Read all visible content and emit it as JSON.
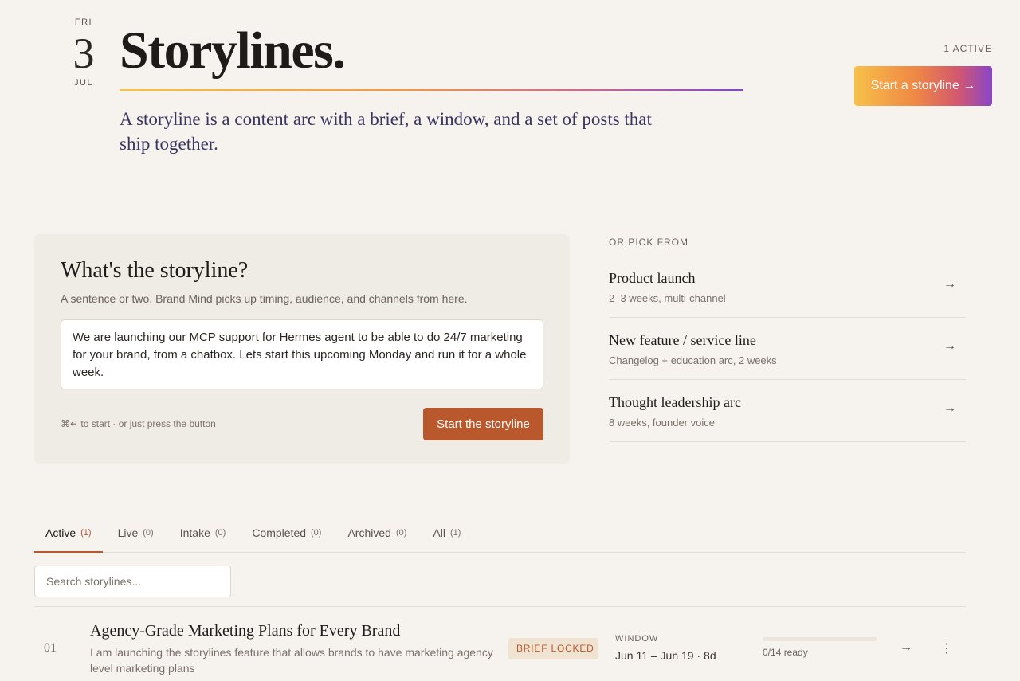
{
  "date": {
    "dow": "FRI",
    "day": "3",
    "month": "JUL"
  },
  "header": {
    "title": "Storylines.",
    "subtitle": "A storyline is a content arc with a brief, a window, and a set of posts that ship together.",
    "active_count": "1 ACTIVE",
    "start_button": "Start a storyline →"
  },
  "composer": {
    "heading": "What's the storyline?",
    "hint": "A sentence or two. Brand Mind picks up timing, audience, and channels from here.",
    "input_value": "We are launching our MCP support for Hermes agent to be able to do 24/7 marketing for your brand, from a chatbox. Lets start this upcoming Monday and run it for a whole week.",
    "shortcut_hint": "⌘↵ to start · or just press the button",
    "submit_label": "Start the storyline"
  },
  "templates": {
    "label": "OR PICK FROM",
    "items": [
      {
        "name": "Product launch",
        "desc": "2–3 weeks, multi-channel"
      },
      {
        "name": "New feature / service line",
        "desc": "Changelog + education arc, 2 weeks"
      },
      {
        "name": "Thought leadership arc",
        "desc": "8 weeks, founder voice"
      }
    ]
  },
  "tabs": [
    {
      "label": "Active",
      "count": "(1)",
      "active": true
    },
    {
      "label": "Live",
      "count": "(0)"
    },
    {
      "label": "Intake",
      "count": "(0)"
    },
    {
      "label": "Completed",
      "count": "(0)"
    },
    {
      "label": "Archived",
      "count": "(0)"
    },
    {
      "label": "All",
      "count": "(1)"
    }
  ],
  "search": {
    "placeholder": "Search storylines..."
  },
  "storylines": [
    {
      "num": "01",
      "title": "Agency-Grade Marketing Plans for Every Brand",
      "desc": "I am launching the storylines feature that allows brands to have marketing agency level marketing plans",
      "badge": "BRIEF LOCKED",
      "window_label": "WINDOW",
      "window_value": "Jun 11 – Jun 19 · 8d",
      "progress": 0,
      "ready": "0/14 ready"
    }
  ],
  "colors": {
    "accent": "#b9572d",
    "background": "#f6f3ee",
    "card": "#efebe5"
  },
  "icons": {
    "arrow": "arrow-right-icon",
    "menu": "kebab-menu-icon"
  }
}
